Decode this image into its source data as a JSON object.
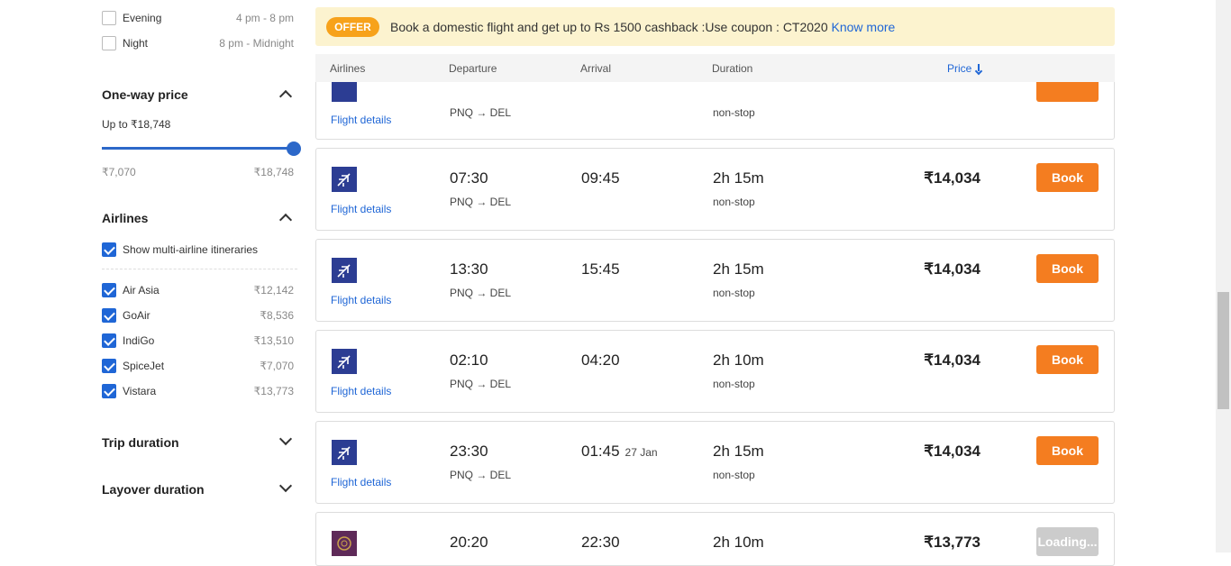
{
  "sidebar": {
    "time_options": [
      {
        "label": "Evening",
        "range": "4 pm - 8 pm",
        "checked": false
      },
      {
        "label": "Night",
        "range": "8 pm - Midnight",
        "checked": false
      }
    ],
    "price_section": {
      "title": "One-way price",
      "up_to": "Up to ₹18,748",
      "min": "₹7,070",
      "max": "₹18,748",
      "slider_fraction": 1.0
    },
    "airlines_section": {
      "title": "Airlines",
      "multi_label": "Show multi-airline itineraries",
      "items": [
        {
          "name": "Air Asia",
          "price": "₹12,142",
          "checked": true
        },
        {
          "name": "GoAir",
          "price": "₹8,536",
          "checked": true
        },
        {
          "name": "IndiGo",
          "price": "₹13,510",
          "checked": true
        },
        {
          "name": "SpiceJet",
          "price": "₹7,070",
          "checked": true
        },
        {
          "name": "Vistara",
          "price": "₹13,773",
          "checked": true
        }
      ]
    },
    "trip_duration_title": "Trip duration",
    "layover_duration_title": "Layover duration"
  },
  "offer": {
    "badge": "OFFER",
    "text": "Book a domestic flight and get up to Rs 1500 cashback :Use coupon : CT2020",
    "link": "Know more"
  },
  "header": {
    "airlines": "Airlines",
    "departure": "Departure",
    "arrival": "Arrival",
    "duration": "Duration",
    "price": "Price"
  },
  "flights": [
    {
      "dep": "07:30",
      "route": "PNQ → DEL",
      "arr": "09:45",
      "next_day": "",
      "duration": "2h 15m",
      "stops": "non-stop",
      "price": "₹14,034",
      "action": "Book",
      "details": "Flight details"
    },
    {
      "dep": "13:30",
      "route": "PNQ → DEL",
      "arr": "15:45",
      "next_day": "",
      "duration": "2h 15m",
      "stops": "non-stop",
      "price": "₹14,034",
      "action": "Book",
      "details": "Flight details"
    },
    {
      "dep": "02:10",
      "route": "PNQ → DEL",
      "arr": "04:20",
      "next_day": "",
      "duration": "2h 10m",
      "stops": "non-stop",
      "price": "₹14,034",
      "action": "Book",
      "details": "Flight details"
    },
    {
      "dep": "23:30",
      "route": "PNQ → DEL",
      "arr": "01:45",
      "next_day": "27 Jan",
      "duration": "2h 15m",
      "stops": "non-stop",
      "price": "₹14,034",
      "action": "Book",
      "details": "Flight details"
    },
    {
      "dep": "20:20",
      "route": "",
      "arr": "22:30",
      "next_day": "",
      "duration": "2h 10m",
      "stops": "",
      "price": "₹13,773",
      "action": "Loading...",
      "details": ""
    }
  ],
  "partial_top": {
    "route": "PNQ → DEL",
    "stops": "non-stop",
    "details": "Flight details"
  },
  "colors": {
    "accent": "#1f66d6",
    "book": "#f47d20",
    "offer_bg": "#fcf3cf",
    "badge": "#f7a21b"
  }
}
